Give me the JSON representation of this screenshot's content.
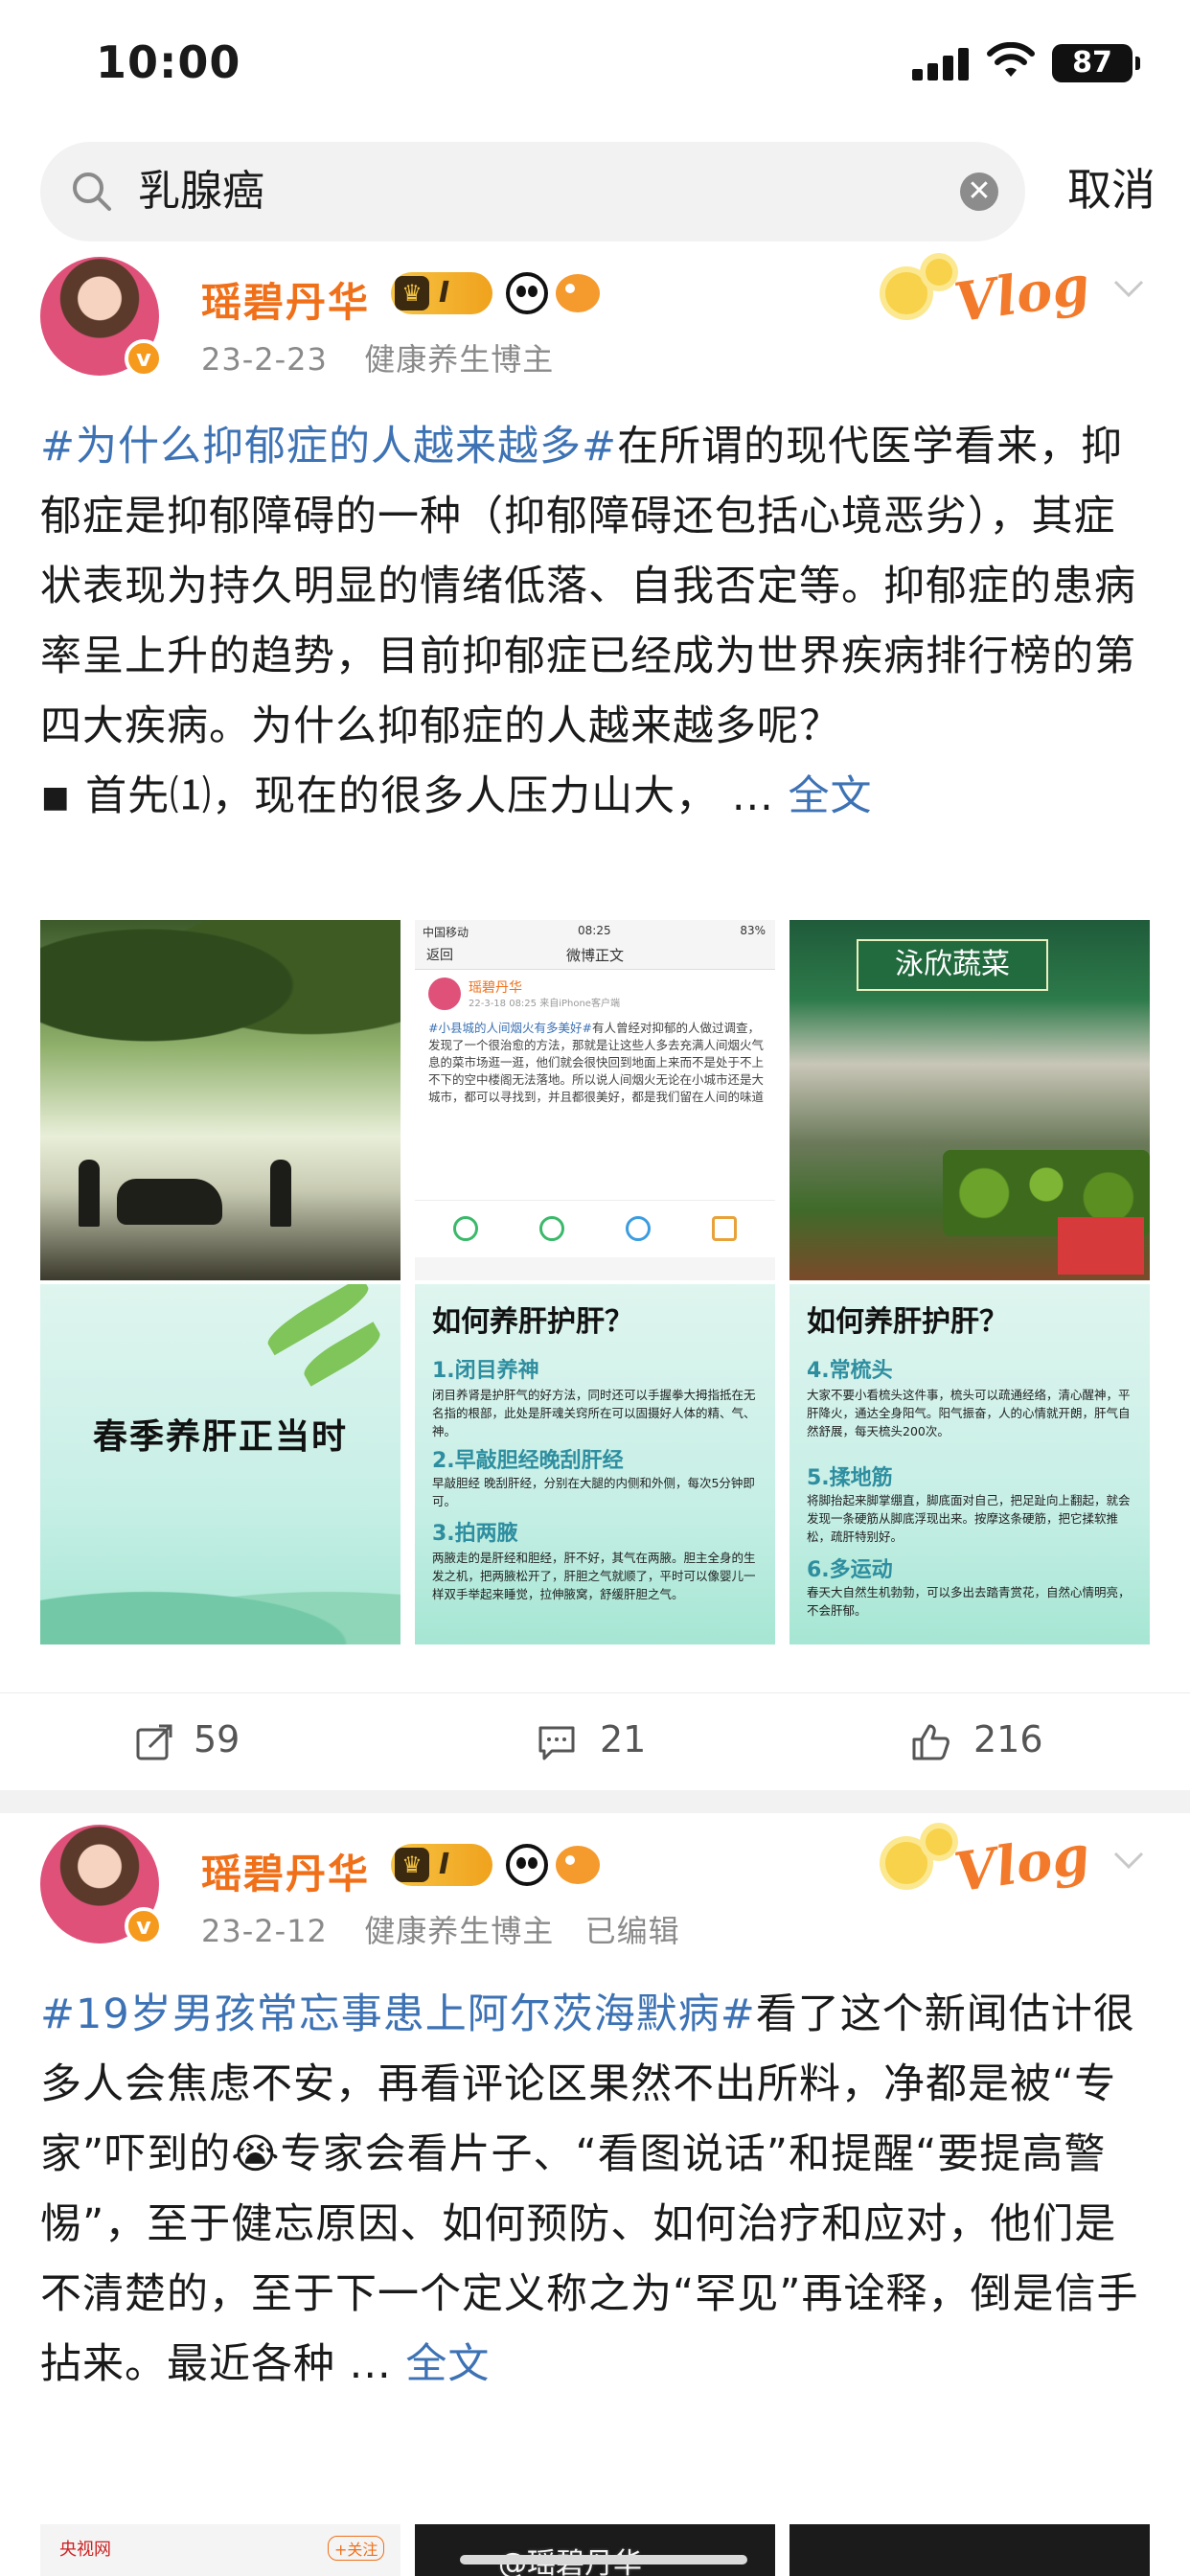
{
  "status": {
    "time": "10:00",
    "battery": "87"
  },
  "search": {
    "query": "乳腺癌",
    "cancel": "取消"
  },
  "posts": [
    {
      "username": "瑶碧丹华",
      "level": "I",
      "date": "23-2-23",
      "category": "健康养生博主",
      "edited": "",
      "badge": "Vlog",
      "topic": "#为什么抑郁症的人越来越多#",
      "text": "在所谓的现代医学看来，抑郁症是抑郁障碍的一种（抑郁障碍还包括心境恶劣），其症状表现为持久明显的情绪低落、自我否定等。抑郁症的患病率呈上升的趋势，目前抑郁症已经成为世界疾病排行榜的第四大疾病。为什么抑郁症的人越来越多呢？",
      "bullet_text": "◾ 首先⑴，现在的很多人压力山大，  ... ",
      "more": "全文",
      "shares": "59",
      "comments": "21",
      "likes": "216"
    },
    {
      "username": "瑶碧丹华",
      "level": "I",
      "date": "23-2-12",
      "category": "健康养生博主",
      "edited": "已编辑",
      "badge": "Vlog",
      "topic": "#19岁男孩常忘事患上阿尔茨海默病#",
      "text": "看了这个新闻估计很多人会焦虑不安，再看评论区果然不出所料，净都是被“专家”吓到的😭专家会看片子、“看图说话”和提醒“要提高警惕”，至于健忘原因、如何预防、如何治疗和应对，他们是不清楚的，至于下一个定义称之为“罕见”再诠释，倒是信手拈来。最近各种 ... ",
      "more": "全文"
    }
  ],
  "images": {
    "phone": {
      "carrier": "中国移动",
      "time": "08:25",
      "battery": "83%",
      "back": "返回",
      "title": "微博正文",
      "name": "瑶碧丹华",
      "date": "22-3-18 08:25 来自iPhone客户端",
      "topic": "#小县城的人间烟火有多美好#",
      "body": "有人曾经对抑郁的人做过调查，发现了一个很治愈的方法，那就是让这些人多去充满人间烟火气息的菜市场逛一逛，他们就会很快回到地面上来而不是处于不上不下的空中楼阁无法落地。所以说人间烟火无论在小城市还是大城市，都可以寻找到，并且都很美好，都是我们留在人间的味道"
    },
    "market": {
      "sign": "泳欣蔬菜"
    },
    "card1": {
      "title": "春季养肝正当时"
    },
    "card2": {
      "title": "如何养肝护肝？",
      "s1": "1.闭目养神",
      "b1": "闭目养肾是护肝气的好方法，同时还可以手握拳大拇指抵在无名指的根部，此处是肝魂关窍所在可以固摄好人体的精、气、神。",
      "s2": "2.早敲胆经晚刮肝经",
      "b2": "早敲胆经 晚刮肝经，分别在大腿的内侧和外侧，每次5分钟即可。",
      "s3": "3.拍两腋",
      "b3": "两腋走的是肝经和胆经，肝不好，其气在两腋。胆主全身的生发之机，把两腋松开了，肝胆之气就顺了，平时可以像婴儿一样双手举起来睡觉，拉伸腋窝，舒缓肝胆之气。"
    },
    "card3": {
      "title": "如何养肝护肝？",
      "s1": "4.常梳头",
      "b1": "大家不要小看梳头这件事，梳头可以疏通经络，清心醒神，平肝降火，通达全身阳气。阳气振奋，人的心情就开朗，肝气自然舒展，每天梳头200次。",
      "s2": "5.揉地筋",
      "b2": "将脚抬起来脚掌绷直，脚底面对自己，把足趾向上翻起，就会发现一条硬筋从脚底浮现出来。按摩这条硬筋，把它揉软推松，疏肝特别好。",
      "s3": "6.多运动",
      "b3": "春天大自然生机勃勃，可以多出去踏青赏花，自然心情明亮，不会肝郁。"
    },
    "bottom": {
      "source": "央视网",
      "follow": "+关注",
      "watermark": "@瑶碧丹华"
    }
  },
  "colors": {
    "accent": "#3d72b4",
    "username": "#f0701a",
    "meta": "#8a8a8a"
  },
  "icons": [
    "search-icon",
    "clear-icon",
    "repost-icon",
    "comment-icon",
    "like-icon",
    "chevron-down-icon",
    "panda-icon",
    "fish-icon",
    "crown-icon",
    "verified-icon"
  ]
}
